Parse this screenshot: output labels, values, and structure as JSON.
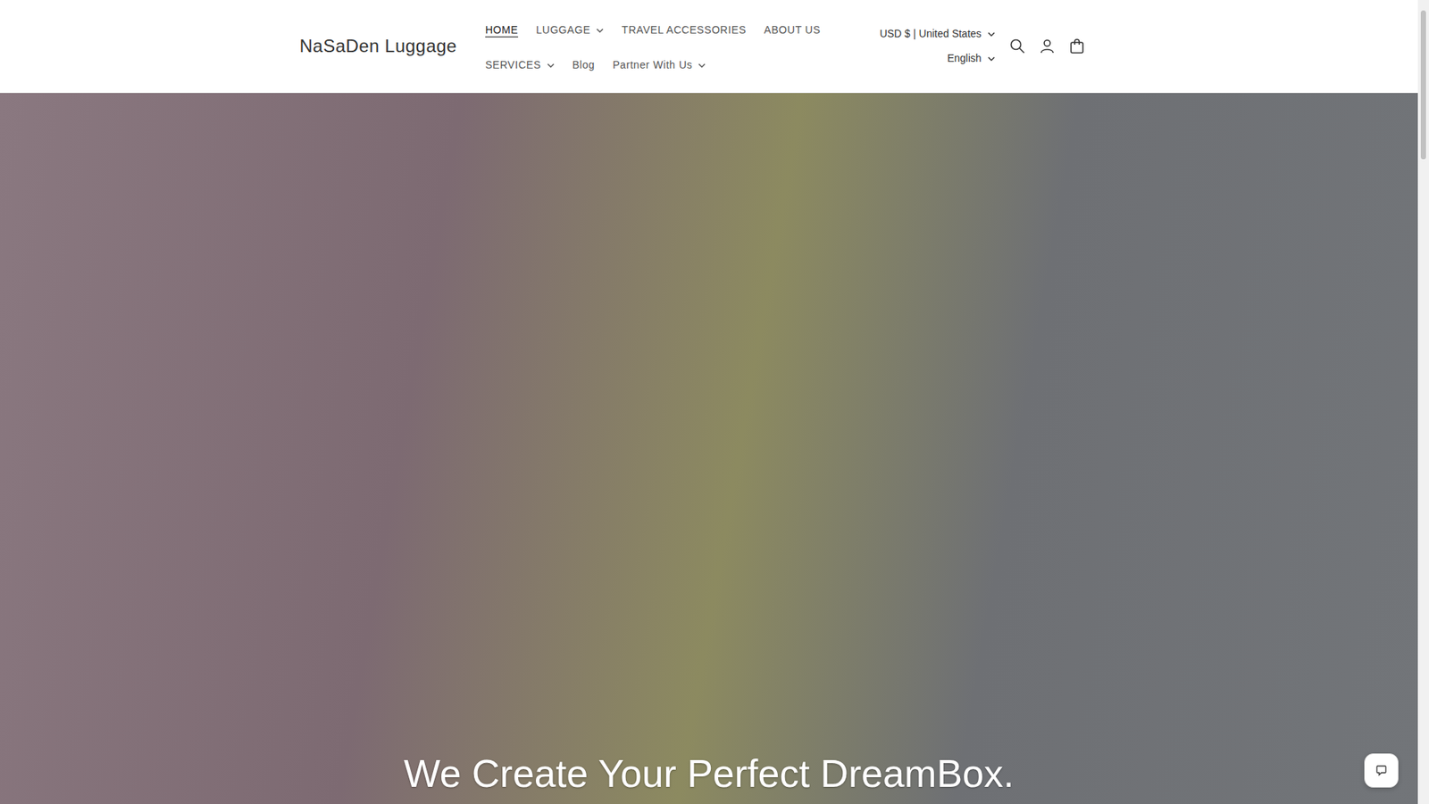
{
  "brand": {
    "name": "NaSaDen Luggage"
  },
  "nav": [
    {
      "label": "HOME",
      "selected": true,
      "kind": "link"
    },
    {
      "label": "LUGGAGE",
      "selected": false,
      "kind": "dropdown"
    },
    {
      "label": "TRAVEL ACCESSORIES",
      "selected": false,
      "kind": "link"
    },
    {
      "label": "ABOUT US",
      "selected": false,
      "kind": "link"
    },
    {
      "label": "SERVICES",
      "selected": false,
      "kind": "dropdown"
    },
    {
      "label": "Blog",
      "selected": false,
      "kind": "link"
    },
    {
      "label": "Partner With Us",
      "selected": false,
      "kind": "dropdown"
    }
  ],
  "locale": {
    "currency": "USD $ | United States",
    "language": "English"
  },
  "hero": {
    "headline": "We Create Your Perfect DreamBox."
  }
}
